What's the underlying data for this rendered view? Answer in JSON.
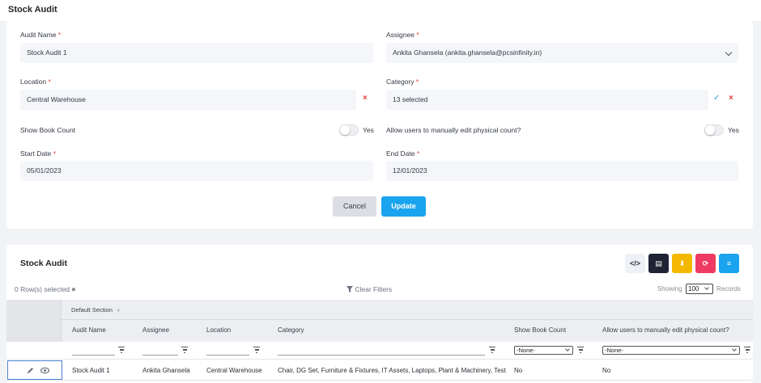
{
  "page": {
    "title": "Stock Audit"
  },
  "form": {
    "audit_name": {
      "label": "Audit Name",
      "required": "*",
      "value": "Stock Audit 1"
    },
    "assignee": {
      "label": "Assignee",
      "required": "*",
      "value": "Ankita Ghansela (ankita.ghansela@pcsinfinity.in)"
    },
    "location": {
      "label": "Location",
      "required": "*",
      "value": "Central Warehouse"
    },
    "category": {
      "label": "Category",
      "required": "*",
      "value": "13 selected"
    },
    "show_book_count": {
      "label": "Show Book Count",
      "toggle_text": "Yes"
    },
    "allow_edit": {
      "label": "Allow users to manually edit physical count?",
      "toggle_text": "Yes"
    },
    "start_date": {
      "label": "Start Date",
      "required": "*",
      "value": "05/01/2023"
    },
    "end_date": {
      "label": "End Date",
      "required": "*",
      "value": "12/01/2023"
    },
    "clear_glyph": "×",
    "check_glyph": "✓",
    "cancel_label": "Cancel",
    "update_label": "Update"
  },
  "grid": {
    "title": "Stock Audit",
    "toolbar": [
      {
        "name": "code-view-icon",
        "glyph": "</>",
        "bg": "#eef1f5",
        "fg": "#2b2f36"
      },
      {
        "name": "document-icon",
        "glyph": "▤",
        "bg": "#1e2433",
        "fg": "#ffffff"
      },
      {
        "name": "download-icon",
        "glyph": "⬇",
        "bg": "#f5b800",
        "fg": "#ffffff"
      },
      {
        "name": "refresh-icon",
        "glyph": "⟳",
        "bg": "#ef3b63",
        "fg": "#ffffff"
      },
      {
        "name": "settings-sliders-icon",
        "glyph": "≡",
        "bg": "#1aa3ee",
        "fg": "#ffffff"
      }
    ],
    "rows_selected": "0 Row(s) selected",
    "rows_selected_clear": "×",
    "clear_filters": "Clear Filters",
    "showing_label": "Showing",
    "page_size": "100",
    "records_label": "Records",
    "group_label": "Default Section",
    "group_chevron": "‹",
    "columns": [
      "Audit Name",
      "Assignee",
      "Location",
      "Category",
      "Show Book Count",
      "Allow users to manually edit physical count?"
    ],
    "filter_select_value": "-None-",
    "rows": [
      {
        "audit_name": "Stock Audit 1",
        "assignee": "Ankita Ghansela",
        "location": "Central Warehouse",
        "category": "Chair, DG Set, Furniture & Fixtures, IT Assets, Laptops, Plant & Machinery, Test",
        "show_book_count": "No",
        "allow_edit": "No"
      }
    ]
  },
  "colors": {
    "accent": "#1aa3ee",
    "required": "#e23a3a"
  }
}
